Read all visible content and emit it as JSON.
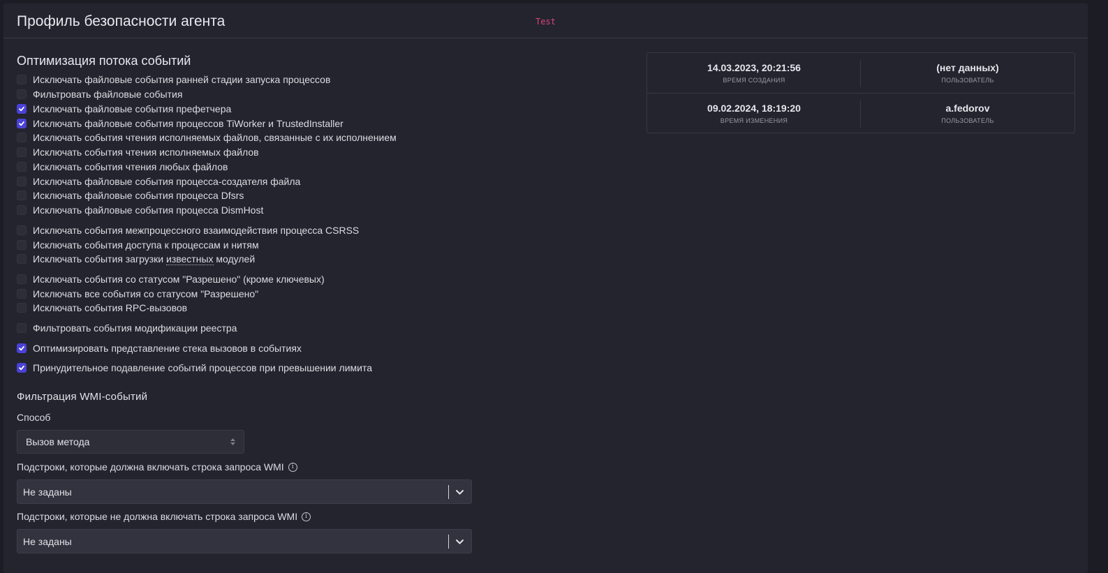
{
  "header": {
    "title": "Профиль безопасности агента",
    "tag": "Test"
  },
  "section": {
    "title": "Оптимизация потока событий"
  },
  "checkboxes": [
    {
      "label": "Исключать файловые события ранней стадии запуска процессов",
      "checked": false
    },
    {
      "label": "Фильтровать файловые события",
      "checked": false
    },
    {
      "label": "Исключать файловые события префетчера",
      "checked": true
    },
    {
      "label": "Исключать файловые события процессов TiWorker и TrustedInstaller",
      "checked": true
    },
    {
      "label": "Исключать события чтения исполняемых файлов, связанные с их исполнением",
      "checked": false
    },
    {
      "label": "Исключать события чтения исполняемых файлов",
      "checked": false
    },
    {
      "label": "Исключать события чтения любых файлов",
      "checked": false
    },
    {
      "label": "Исключать файловые события процесса-создателя файла",
      "checked": false
    },
    {
      "label": "Исключать файловые события процесса Dfsrs",
      "checked": false
    },
    {
      "label": "Исключать файловые события процесса DismHost",
      "checked": false
    },
    {
      "label": "Исключать события межпроцессного взаимодействия процесса CSRSS",
      "checked": false
    },
    {
      "label": "Исключать события доступа к процессам и нитям",
      "checked": false
    },
    {
      "label_prefix": "Исключать события загрузки ",
      "label_link": "известных",
      "label_suffix": " модулей",
      "checked": false
    },
    {
      "label": "Исключать события со статусом \"Разрешено\" (кроме ключевых)",
      "checked": false
    },
    {
      "label": "Исключать все события со статусом \"Разрешено\"",
      "checked": false
    },
    {
      "label": "Исключать события RPC-вызовов",
      "checked": false
    },
    {
      "label": "Фильтровать события модификации реестра",
      "checked": false
    },
    {
      "label": "Оптимизировать представление стека вызовов в событиях",
      "checked": true
    },
    {
      "label": "Принудительное подавление событий процессов при превышении лимита",
      "checked": true
    }
  ],
  "wmi": {
    "title": "Фильтрация WMI-событий",
    "method_label": "Способ",
    "method_value": "Вызов метода",
    "include_label": "Подстроки, которые должна включать строка запроса WMI",
    "include_value": "Не заданы",
    "exclude_label": "Подстроки, которые не должна включать строка запроса WMI",
    "exclude_value": "Не заданы"
  },
  "meta": {
    "created_time": "14.03.2023, 20:21:56",
    "created_time_label": "ВРЕМЯ СОЗДАНИЯ",
    "created_user": "(нет данных)",
    "created_user_label": "ПОЛЬЗОВАТЕЛЬ",
    "modified_time": "09.02.2024, 18:19:20",
    "modified_time_label": "ВРЕМЯ ИЗМЕНЕНИЯ",
    "modified_user": "a.fedorov",
    "modified_user_label": "ПОЛЬЗОВАТЕЛЬ"
  },
  "colors": {
    "accent": "#4a42d6",
    "tag": "#d9467b",
    "background": "#23242d"
  }
}
